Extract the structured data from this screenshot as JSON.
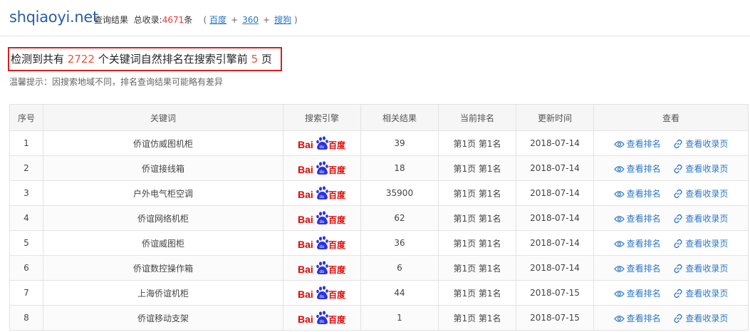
{
  "header": {
    "site": "shqiaoyi.net",
    "query_label": "查询结果",
    "total_label": "总收录:",
    "total_count": "4671",
    "total_unit": "条",
    "paren_open": "(",
    "paren_close": ")",
    "plus": "+",
    "engines": [
      "百度",
      "360",
      "搜狗"
    ]
  },
  "summary": {
    "prefix": "检测到共有",
    "count": "2722",
    "middle": "个关键词自然排名在搜索引擎前",
    "pages": "5",
    "suffix": "页"
  },
  "tip": "温馨提示：因搜索地域不同，排名查询结果可能略有差异",
  "table": {
    "headers": [
      "序号",
      "关键词",
      "搜索引擎",
      "相关结果",
      "当前排名",
      "更新时间",
      "查看"
    ],
    "view_rank_label": "查看排名",
    "view_index_label": "查看收录页",
    "rows": [
      {
        "no": "1",
        "keyword": "侨谊仿威图机柜",
        "results": "39",
        "rank": "第1页 第1名",
        "date": "2018-07-14"
      },
      {
        "no": "2",
        "keyword": "侨谊接线箱",
        "results": "18",
        "rank": "第1页 第1名",
        "date": "2018-07-14"
      },
      {
        "no": "3",
        "keyword": "户外电气柜空调",
        "results": "35900",
        "rank": "第1页 第1名",
        "date": "2018-07-14"
      },
      {
        "no": "4",
        "keyword": "侨谊网络机柜",
        "results": "62",
        "rank": "第1页 第1名",
        "date": "2018-07-14"
      },
      {
        "no": "5",
        "keyword": "侨谊威图柜",
        "results": "36",
        "rank": "第1页 第1名",
        "date": "2018-07-14"
      },
      {
        "no": "6",
        "keyword": "侨谊数控操作箱",
        "results": "6",
        "rank": "第1页 第1名",
        "date": "2018-07-14"
      },
      {
        "no": "7",
        "keyword": "上海侨谊机柜",
        "results": "44",
        "rank": "第1页 第1名",
        "date": "2018-07-15"
      },
      {
        "no": "8",
        "keyword": "侨谊移动支架",
        "results": "1",
        "rank": "第1页 第1名",
        "date": "2018-07-15"
      }
    ]
  },
  "baidu_logo": {
    "text_bai": "Bai",
    "text_du": "百度",
    "paw": "du"
  },
  "colors": {
    "accent": "#2a76c9",
    "red": "#e4393c",
    "baidu_red": "#e10602",
    "baidu_blue": "#2932e1"
  }
}
